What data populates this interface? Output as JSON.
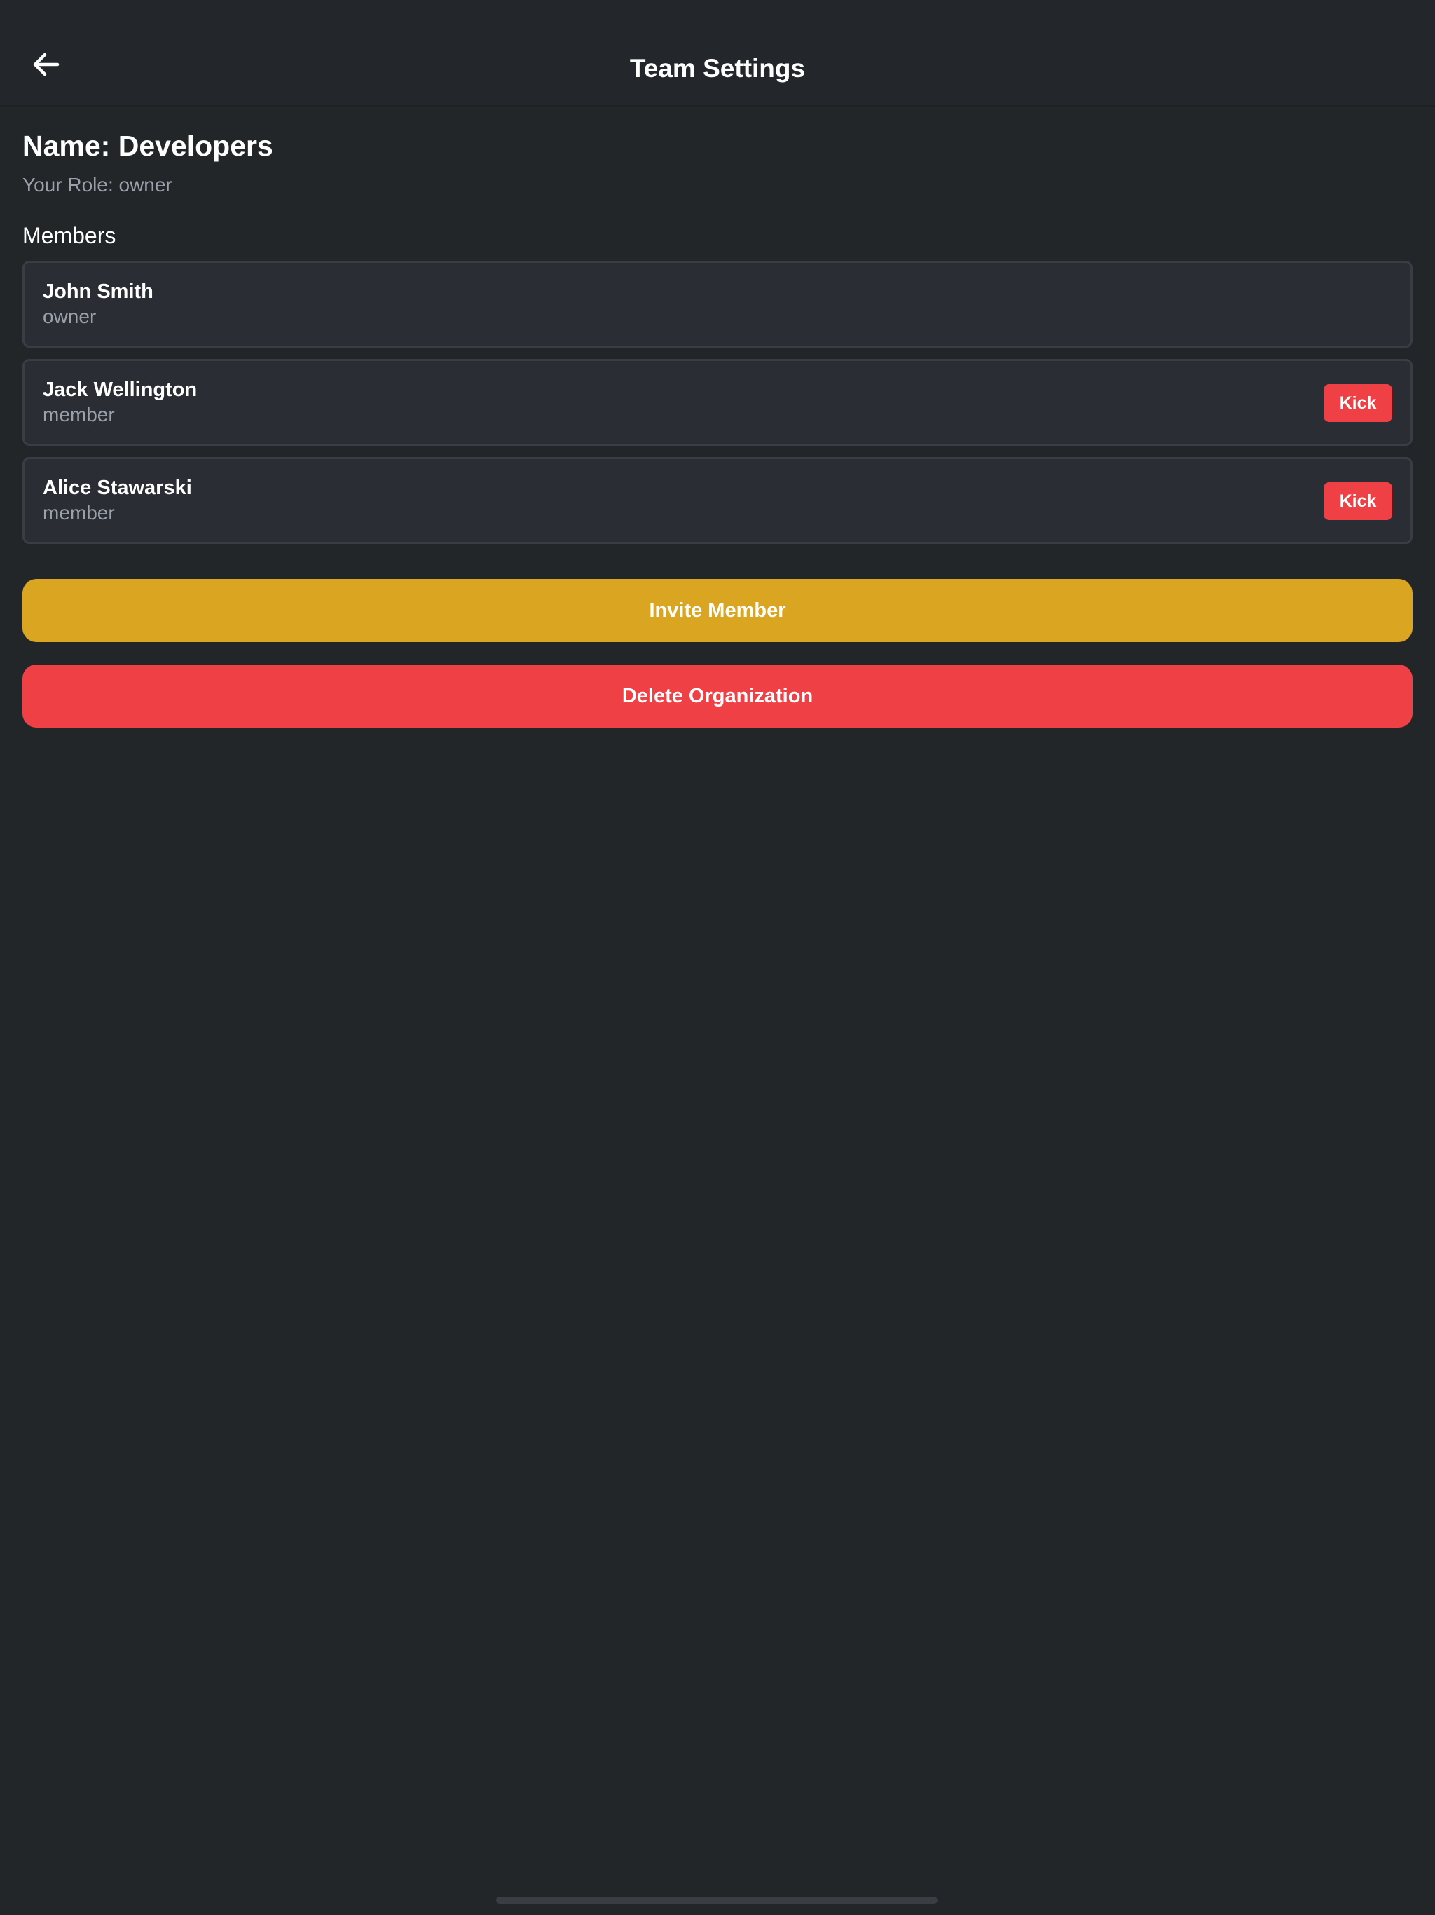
{
  "header": {
    "title": "Team Settings",
    "back_icon": "arrow-left-icon"
  },
  "team": {
    "name": "Name: Developers",
    "role": "Your Role: owner"
  },
  "members": {
    "heading": "Members",
    "items": [
      {
        "name": "John Smith",
        "role": "owner",
        "kick_label": ""
      },
      {
        "name": "Jack Wellington",
        "role": "member",
        "kick_label": "Kick"
      },
      {
        "name": "Alice Stawarski",
        "role": "member",
        "kick_label": "Kick"
      }
    ]
  },
  "actions": {
    "invite_label": "Invite Member",
    "delete_label": "Delete Organization"
  },
  "colors": {
    "background": "#222629",
    "card": "#2a2d33",
    "accent_gold": "#daa521",
    "danger_red": "#ef4046",
    "muted_text": "#9aa1ab"
  }
}
